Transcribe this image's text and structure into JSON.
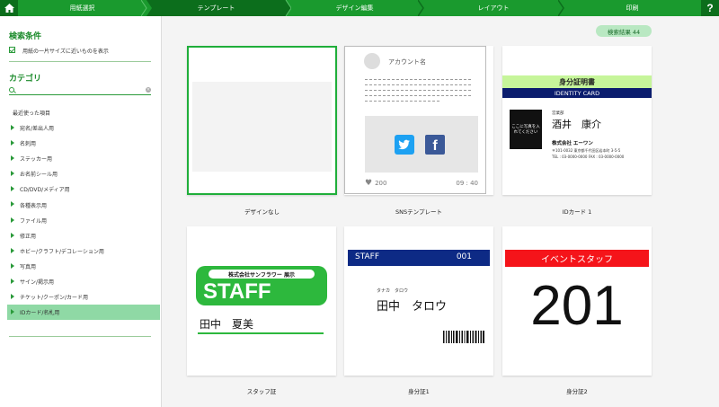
{
  "topbar": {
    "steps": [
      {
        "label": "用紙選択",
        "state": "done"
      },
      {
        "label": "テンプレート",
        "state": "active"
      },
      {
        "label": "デザイン編集",
        "state": "pending"
      },
      {
        "label": "レイアウト",
        "state": "pending"
      },
      {
        "label": "印刷",
        "state": "pending"
      }
    ],
    "help_label": "?",
    "icons": {
      "home": "home-icon"
    },
    "colors": {
      "bar": "#1a9a2e",
      "active": "#0c6e1c"
    }
  },
  "sidebar": {
    "search_title": "検索条件",
    "checkbox_label": "用紙の一片サイズに近いものを表示",
    "category_title": "カテゴリ",
    "search": {
      "value": "",
      "placeholder": ""
    },
    "recent_label": "最近使った項目",
    "categories": [
      "宛名/差出人用",
      "名刺用",
      "ステッカー用",
      "お名前シール用",
      "CD/DVD/メディア用",
      "各種表示用",
      "ファイル用",
      "修正用",
      "ホビー/クラフト/デコレーション用",
      "写真用",
      "サイン/掲示用",
      "チケット/クーポン/カード用",
      "IDカード/名札用"
    ],
    "selected_index": 12
  },
  "main": {
    "result_label": "検索結果 44",
    "templates": [
      {
        "label": "デザインなし"
      },
      {
        "label": "SNSテンプレート"
      },
      {
        "label": "IDカード 1"
      },
      {
        "label": "スタッフ証"
      },
      {
        "label": "身分証1"
      },
      {
        "label": "身分証2"
      }
    ],
    "sns": {
      "account": "アカウント名",
      "likes": "200",
      "time": "09 : 40",
      "twitter_glyph": "🐦",
      "facebook_glyph": "f"
    },
    "id1": {
      "title": "身分証明書",
      "band": "IDENTITY CARD",
      "dept": "営業部",
      "name": "酒井　康介",
      "company": "株式会社 エーワン",
      "address": "〒101-0032 東京都千代田区岩本町 3-5-5",
      "tel": "TEL : 03-0000-0000 FAX : 03-0000-0000",
      "photo_text": "ここに写真を入れてください"
    },
    "staff": {
      "company": "株式会社サンフラワー 展示",
      "title": "STAFF",
      "name": "田中　夏美"
    },
    "id2": {
      "band_left": "STAFF",
      "band_right": "001",
      "reading": "タナカ　タロウ",
      "name": "田中　タロウ"
    },
    "id3": {
      "band": "イベントスタッフ",
      "number": "201"
    }
  }
}
